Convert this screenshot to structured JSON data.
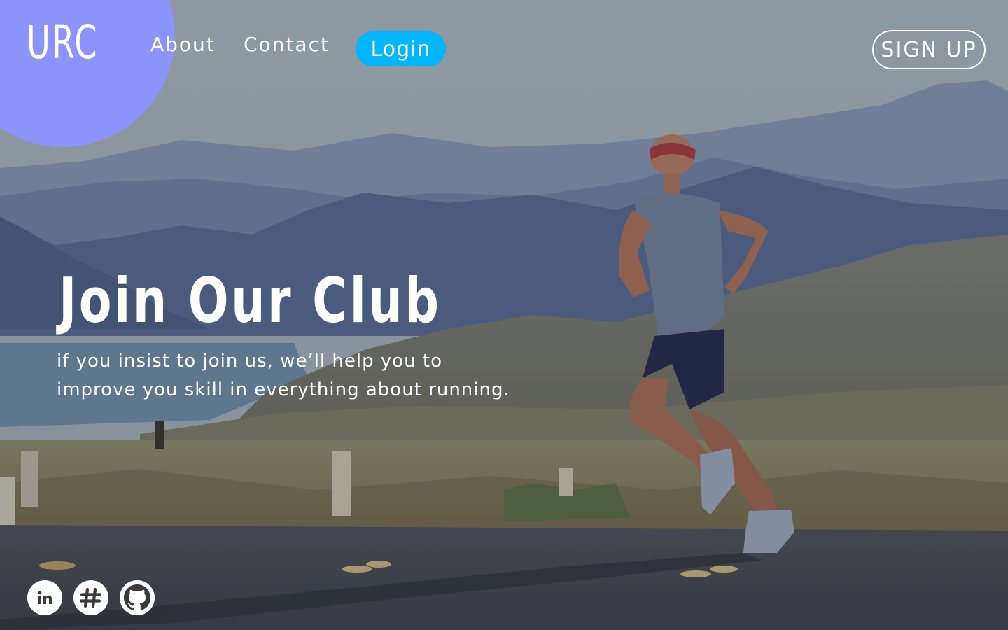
{
  "brand": {
    "logo": "URC",
    "accent_color": "#8a94fb"
  },
  "nav": {
    "about": "About",
    "contact": "Contact",
    "login": "Login",
    "login_color": "#00b7ff",
    "signup": "SIGN UP"
  },
  "hero": {
    "title": "Join Our Club",
    "subtitle_line1": "if you insist to join us, we’ll help you to",
    "subtitle_line2": "improve you skill in everything about running.",
    "background_image": "runner-on-desert-road-photo"
  },
  "social": [
    {
      "icon": "linkedin-icon",
      "glyph": "in"
    },
    {
      "icon": "slack-icon",
      "glyph": "#"
    },
    {
      "icon": "github-icon",
      "glyph": "octocat"
    }
  ]
}
